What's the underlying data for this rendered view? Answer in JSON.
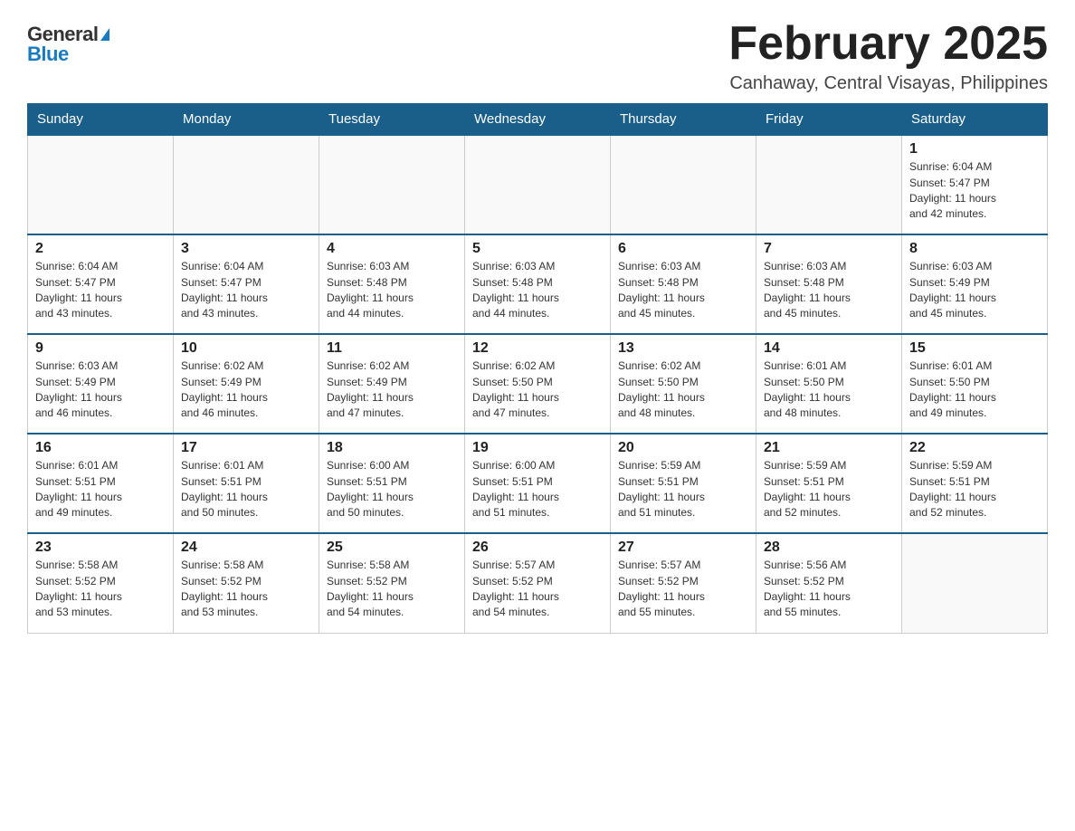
{
  "logo": {
    "general": "General",
    "blue": "Blue"
  },
  "title": "February 2025",
  "location": "Canhaway, Central Visayas, Philippines",
  "weekdays": [
    "Sunday",
    "Monday",
    "Tuesday",
    "Wednesday",
    "Thursday",
    "Friday",
    "Saturday"
  ],
  "weeks": [
    [
      {
        "day": "",
        "info": ""
      },
      {
        "day": "",
        "info": ""
      },
      {
        "day": "",
        "info": ""
      },
      {
        "day": "",
        "info": ""
      },
      {
        "day": "",
        "info": ""
      },
      {
        "day": "",
        "info": ""
      },
      {
        "day": "1",
        "info": "Sunrise: 6:04 AM\nSunset: 5:47 PM\nDaylight: 11 hours\nand 42 minutes."
      }
    ],
    [
      {
        "day": "2",
        "info": "Sunrise: 6:04 AM\nSunset: 5:47 PM\nDaylight: 11 hours\nand 43 minutes."
      },
      {
        "day": "3",
        "info": "Sunrise: 6:04 AM\nSunset: 5:47 PM\nDaylight: 11 hours\nand 43 minutes."
      },
      {
        "day": "4",
        "info": "Sunrise: 6:03 AM\nSunset: 5:48 PM\nDaylight: 11 hours\nand 44 minutes."
      },
      {
        "day": "5",
        "info": "Sunrise: 6:03 AM\nSunset: 5:48 PM\nDaylight: 11 hours\nand 44 minutes."
      },
      {
        "day": "6",
        "info": "Sunrise: 6:03 AM\nSunset: 5:48 PM\nDaylight: 11 hours\nand 45 minutes."
      },
      {
        "day": "7",
        "info": "Sunrise: 6:03 AM\nSunset: 5:48 PM\nDaylight: 11 hours\nand 45 minutes."
      },
      {
        "day": "8",
        "info": "Sunrise: 6:03 AM\nSunset: 5:49 PM\nDaylight: 11 hours\nand 45 minutes."
      }
    ],
    [
      {
        "day": "9",
        "info": "Sunrise: 6:03 AM\nSunset: 5:49 PM\nDaylight: 11 hours\nand 46 minutes."
      },
      {
        "day": "10",
        "info": "Sunrise: 6:02 AM\nSunset: 5:49 PM\nDaylight: 11 hours\nand 46 minutes."
      },
      {
        "day": "11",
        "info": "Sunrise: 6:02 AM\nSunset: 5:49 PM\nDaylight: 11 hours\nand 47 minutes."
      },
      {
        "day": "12",
        "info": "Sunrise: 6:02 AM\nSunset: 5:50 PM\nDaylight: 11 hours\nand 47 minutes."
      },
      {
        "day": "13",
        "info": "Sunrise: 6:02 AM\nSunset: 5:50 PM\nDaylight: 11 hours\nand 48 minutes."
      },
      {
        "day": "14",
        "info": "Sunrise: 6:01 AM\nSunset: 5:50 PM\nDaylight: 11 hours\nand 48 minutes."
      },
      {
        "day": "15",
        "info": "Sunrise: 6:01 AM\nSunset: 5:50 PM\nDaylight: 11 hours\nand 49 minutes."
      }
    ],
    [
      {
        "day": "16",
        "info": "Sunrise: 6:01 AM\nSunset: 5:51 PM\nDaylight: 11 hours\nand 49 minutes."
      },
      {
        "day": "17",
        "info": "Sunrise: 6:01 AM\nSunset: 5:51 PM\nDaylight: 11 hours\nand 50 minutes."
      },
      {
        "day": "18",
        "info": "Sunrise: 6:00 AM\nSunset: 5:51 PM\nDaylight: 11 hours\nand 50 minutes."
      },
      {
        "day": "19",
        "info": "Sunrise: 6:00 AM\nSunset: 5:51 PM\nDaylight: 11 hours\nand 51 minutes."
      },
      {
        "day": "20",
        "info": "Sunrise: 5:59 AM\nSunset: 5:51 PM\nDaylight: 11 hours\nand 51 minutes."
      },
      {
        "day": "21",
        "info": "Sunrise: 5:59 AM\nSunset: 5:51 PM\nDaylight: 11 hours\nand 52 minutes."
      },
      {
        "day": "22",
        "info": "Sunrise: 5:59 AM\nSunset: 5:51 PM\nDaylight: 11 hours\nand 52 minutes."
      }
    ],
    [
      {
        "day": "23",
        "info": "Sunrise: 5:58 AM\nSunset: 5:52 PM\nDaylight: 11 hours\nand 53 minutes."
      },
      {
        "day": "24",
        "info": "Sunrise: 5:58 AM\nSunset: 5:52 PM\nDaylight: 11 hours\nand 53 minutes."
      },
      {
        "day": "25",
        "info": "Sunrise: 5:58 AM\nSunset: 5:52 PM\nDaylight: 11 hours\nand 54 minutes."
      },
      {
        "day": "26",
        "info": "Sunrise: 5:57 AM\nSunset: 5:52 PM\nDaylight: 11 hours\nand 54 minutes."
      },
      {
        "day": "27",
        "info": "Sunrise: 5:57 AM\nSunset: 5:52 PM\nDaylight: 11 hours\nand 55 minutes."
      },
      {
        "day": "28",
        "info": "Sunrise: 5:56 AM\nSunset: 5:52 PM\nDaylight: 11 hours\nand 55 minutes."
      },
      {
        "day": "",
        "info": ""
      }
    ]
  ]
}
